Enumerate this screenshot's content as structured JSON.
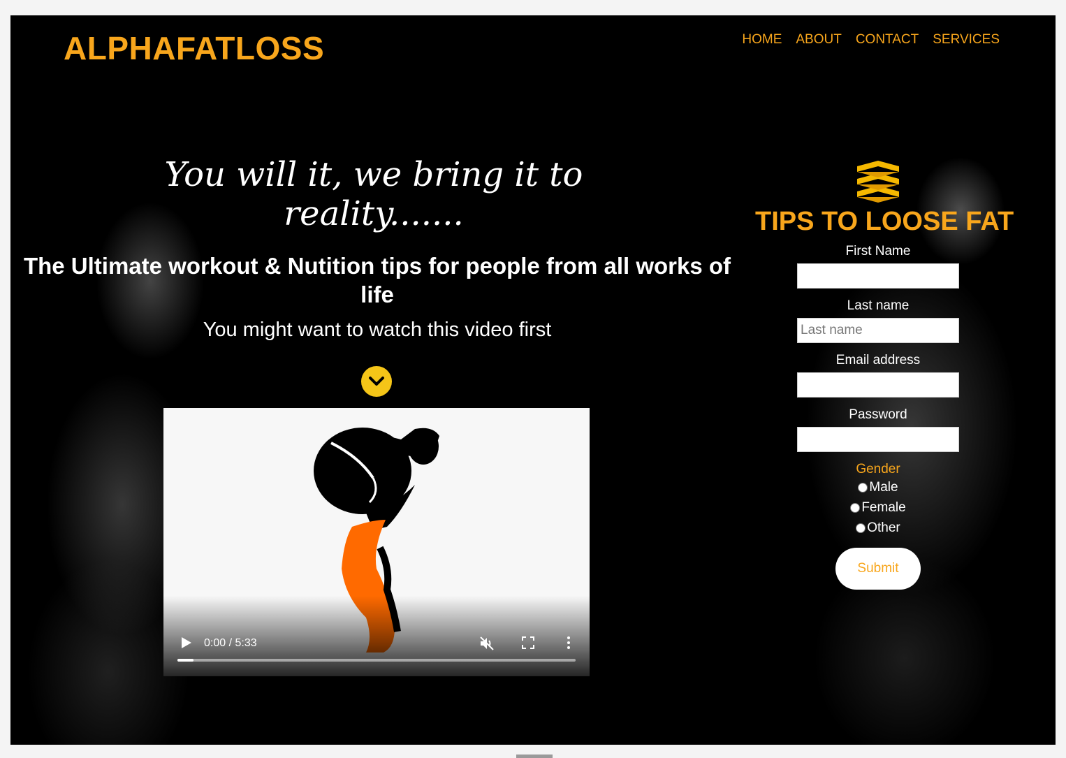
{
  "brand": {
    "logo_text": "ALPHAFATLOSS"
  },
  "nav": {
    "items": [
      "HOME",
      "ABOUT",
      "CONTACT",
      "SERVICES"
    ]
  },
  "hero": {
    "tagline": "You will it, we bring it to reality.......",
    "headline": "The Ultimate workout & Nutition tips for people from all works of life",
    "subline": "You might want to watch this video first",
    "scroll_icon": "chevron-down-circle-icon"
  },
  "video": {
    "time": "0:00 / 5:33",
    "progress": 0.04,
    "icons": [
      "play-icon",
      "muted-icon",
      "fullscreen-icon",
      "more-vertical-icon"
    ]
  },
  "form": {
    "icon": "stacked-chevrons-icon",
    "title": "TIPS TO LOOSE FAT",
    "first_name_label": "First Name",
    "first_name_value": "",
    "last_name_label": "Last name",
    "last_name_placeholder": "Last name",
    "email_label": "Email address",
    "password_label": "Password",
    "gender_label": "Gender",
    "gender_options": [
      "Male",
      "Female",
      "Other"
    ],
    "submit_label": "Submit"
  },
  "colors": {
    "accent": "#f8a61c",
    "background": "#000000",
    "scroll_button": "#f5c518",
    "figure_orange": "#ff6a00"
  }
}
